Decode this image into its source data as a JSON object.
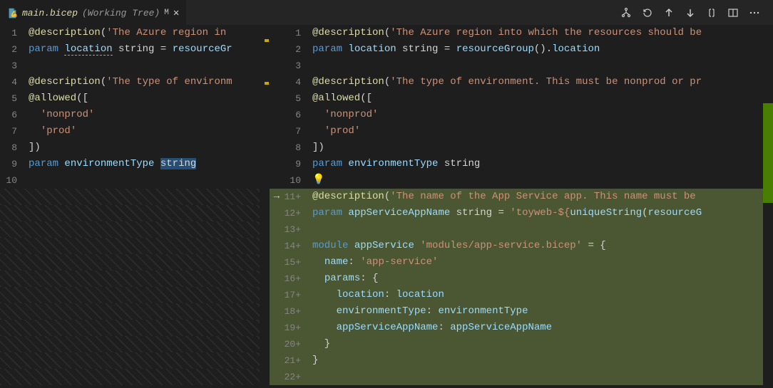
{
  "tab": {
    "filename": "main.bicep",
    "suffix": "(Working Tree)",
    "modifiedBadge": "M"
  },
  "toolbarIcons": [
    "tree",
    "revert",
    "up",
    "down",
    "whitespace",
    "split",
    "more"
  ],
  "left": {
    "lines": [
      {
        "n": 1,
        "tokens": [
          [
            "func",
            "@description"
          ],
          [
            "punc",
            "("
          ],
          [
            "str",
            "'The Azure region in"
          ]
        ]
      },
      {
        "n": 2,
        "tokens": [
          [
            "kw",
            "param"
          ],
          [
            "punc",
            " "
          ],
          [
            "var",
            "location",
            "warn"
          ],
          [
            "punc",
            " "
          ],
          [
            "type",
            "string"
          ],
          [
            "punc",
            " = "
          ],
          [
            "var",
            "resourceGr"
          ]
        ]
      },
      {
        "n": 3,
        "tokens": []
      },
      {
        "n": 4,
        "tokens": [
          [
            "func",
            "@description"
          ],
          [
            "punc",
            "("
          ],
          [
            "str",
            "'The type of environm"
          ]
        ]
      },
      {
        "n": 5,
        "tokens": [
          [
            "func",
            "@allowed"
          ],
          [
            "punc",
            "(["
          ]
        ]
      },
      {
        "n": 6,
        "tokens": [
          [
            "punc",
            "  "
          ],
          [
            "str",
            "'nonprod'"
          ]
        ]
      },
      {
        "n": 7,
        "tokens": [
          [
            "punc",
            "  "
          ],
          [
            "str",
            "'prod'"
          ]
        ]
      },
      {
        "n": 8,
        "tokens": [
          [
            "punc",
            "])"
          ]
        ]
      },
      {
        "n": 9,
        "tokens": [
          [
            "kw",
            "param"
          ],
          [
            "punc",
            " "
          ],
          [
            "var",
            "environmentType"
          ],
          [
            "punc",
            " "
          ],
          [
            "type",
            "string",
            "hl"
          ]
        ]
      },
      {
        "n": 10,
        "tokens": []
      }
    ]
  },
  "right": {
    "lines": [
      {
        "n": 1,
        "tokens": [
          [
            "func",
            "@description"
          ],
          [
            "punc",
            "("
          ],
          [
            "str",
            "'The Azure region into which the resources should be"
          ]
        ]
      },
      {
        "n": 2,
        "tokens": [
          [
            "kw",
            "param"
          ],
          [
            "punc",
            " "
          ],
          [
            "var",
            "location"
          ],
          [
            "punc",
            " "
          ],
          [
            "type",
            "string"
          ],
          [
            "punc",
            " = "
          ],
          [
            "var",
            "resourceGroup"
          ],
          [
            "punc",
            "()."
          ],
          [
            "var",
            "location"
          ]
        ]
      },
      {
        "n": 3,
        "tokens": []
      },
      {
        "n": 4,
        "tokens": [
          [
            "func",
            "@description"
          ],
          [
            "punc",
            "("
          ],
          [
            "str",
            "'The type of environment. This must be nonprod or pr"
          ]
        ]
      },
      {
        "n": 5,
        "tokens": [
          [
            "func",
            "@allowed"
          ],
          [
            "punc",
            "(["
          ]
        ]
      },
      {
        "n": 6,
        "tokens": [
          [
            "punc",
            "  "
          ],
          [
            "str",
            "'nonprod'"
          ]
        ]
      },
      {
        "n": 7,
        "tokens": [
          [
            "punc",
            "  "
          ],
          [
            "str",
            "'prod'"
          ]
        ]
      },
      {
        "n": 8,
        "tokens": [
          [
            "punc",
            "])"
          ]
        ]
      },
      {
        "n": 9,
        "tokens": [
          [
            "kw",
            "param"
          ],
          [
            "punc",
            " "
          ],
          [
            "var",
            "environmentType"
          ],
          [
            "punc",
            " "
          ],
          [
            "type",
            "string"
          ]
        ]
      },
      {
        "n": 10,
        "bulb": true,
        "tokens": []
      },
      {
        "n": "11",
        "plus": true,
        "arrow": true,
        "added": true,
        "tokens": [
          [
            "func",
            "@description"
          ],
          [
            "punc",
            "("
          ],
          [
            "str",
            "'The name of the App Service app. This name must be"
          ]
        ]
      },
      {
        "n": "12",
        "plus": true,
        "added": true,
        "tokens": [
          [
            "kw",
            "param"
          ],
          [
            "punc",
            " "
          ],
          [
            "var",
            "appServiceAppName"
          ],
          [
            "punc",
            " "
          ],
          [
            "type",
            "string"
          ],
          [
            "punc",
            " = "
          ],
          [
            "str",
            "'toyweb-${"
          ],
          [
            "var",
            "uniqueString"
          ],
          [
            "punc",
            "("
          ],
          [
            "var",
            "resourceG"
          ]
        ]
      },
      {
        "n": "13",
        "plus": true,
        "added": true,
        "tokens": []
      },
      {
        "n": "14",
        "plus": true,
        "added": true,
        "tokens": [
          [
            "kw",
            "module"
          ],
          [
            "punc",
            " "
          ],
          [
            "var",
            "appService"
          ],
          [
            "punc",
            " "
          ],
          [
            "str",
            "'modules/app-service.bicep'"
          ],
          [
            "punc",
            " = {"
          ]
        ]
      },
      {
        "n": "15",
        "plus": true,
        "added": true,
        "tokens": [
          [
            "punc",
            "  "
          ],
          [
            "prop",
            "name"
          ],
          [
            "punc",
            ": "
          ],
          [
            "str",
            "'app-service'"
          ]
        ]
      },
      {
        "n": "16",
        "plus": true,
        "added": true,
        "tokens": [
          [
            "punc",
            "  "
          ],
          [
            "prop",
            "params"
          ],
          [
            "punc",
            ": {"
          ]
        ]
      },
      {
        "n": "17",
        "plus": true,
        "added": true,
        "tokens": [
          [
            "punc",
            "    "
          ],
          [
            "prop",
            "location"
          ],
          [
            "punc",
            ": "
          ],
          [
            "var",
            "location"
          ]
        ]
      },
      {
        "n": "18",
        "plus": true,
        "added": true,
        "tokens": [
          [
            "punc",
            "    "
          ],
          [
            "prop",
            "environmentType"
          ],
          [
            "punc",
            ": "
          ],
          [
            "var",
            "environmentType"
          ]
        ]
      },
      {
        "n": "19",
        "plus": true,
        "added": true,
        "tokens": [
          [
            "punc",
            "    "
          ],
          [
            "prop",
            "appServiceAppName"
          ],
          [
            "punc",
            ": "
          ],
          [
            "var",
            "appServiceAppName"
          ]
        ]
      },
      {
        "n": "20",
        "plus": true,
        "added": true,
        "tokens": [
          [
            "punc",
            "  }"
          ]
        ]
      },
      {
        "n": "21",
        "plus": true,
        "added": true,
        "tokens": [
          [
            "punc",
            "}"
          ]
        ]
      },
      {
        "n": "22",
        "plus": true,
        "added": true,
        "tokens": []
      }
    ]
  }
}
